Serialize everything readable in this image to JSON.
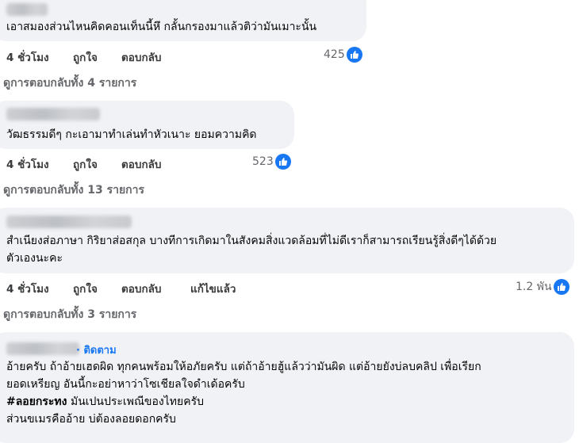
{
  "comments": [
    {
      "text_lines": [
        "เอาสมองส่วนไหนคิดคอนเท็นนี้หึ กลั้นกรองมาแล้วติว่ามันเมาะนั้น"
      ],
      "time": "4 ชั่วโมง",
      "like": "ถูกใจ",
      "reply": "ตอบกลับ",
      "reaction_count": "425",
      "replies_link": "ดูการตอบกลับทั้ง 4 รายการ"
    },
    {
      "text_lines": [
        "วัฒธรรมดีๆ กะเอามาทำเล่นทำหัวเนาะ ยอมความคิด"
      ],
      "time": "4 ชั่วโมง",
      "like": "ถูกใจ",
      "reply": "ตอบกลับ",
      "reaction_count": "523",
      "replies_link": "ดูการตอบกลับทั้ง 13 รายการ"
    },
    {
      "text_lines": [
        "สำเนียงส่อภาษา กิริยาส่อสกุล บางทีการเกิดมาในสังคมสิ่งแวดล้อมที่ไม่ดีเราก็สามารถเรียนรู้สิ่งดีๆได้ด้วย",
        "ตัวเองนะคะ"
      ],
      "time": "4 ชั่วโมง",
      "like": "ถูกใจ",
      "reply": "ตอบกลับ",
      "edited": "แก้ไขแล้ว",
      "reaction_count": "1.2 พัน",
      "replies_link": "ดูการตอบกลับทั้ง 3 รายการ"
    },
    {
      "follow": "· ติดตาม",
      "text_lines": [
        "อ้ายครับ ถ้าอ้ายเฮดผิด ทุกคนพร้อมให้อภัยครับ แต่ถ้าอ้ายฮู้แล้วว่ามันผิด แต่อ้ายยังบ่ลบคลิป เพื่อเรียก",
        "ยอดเหรียญ อันนี้กะอย่าหาว่าโซเชียลใจดำเด้อครับ"
      ],
      "hashtag": "#ลอยกระทง",
      "hashtag_rest": " มันเปนประเพณีของไทยครับ",
      "last_line": "ส่วนขเมรคืออ้าย บ่ต้องลอยดอกครับ"
    }
  ],
  "icons": {
    "reaction": "like-icon"
  },
  "colors": {
    "bubble": "#f0f2f5",
    "like_blue": "#1877f2",
    "secondary": "#65676b"
  }
}
